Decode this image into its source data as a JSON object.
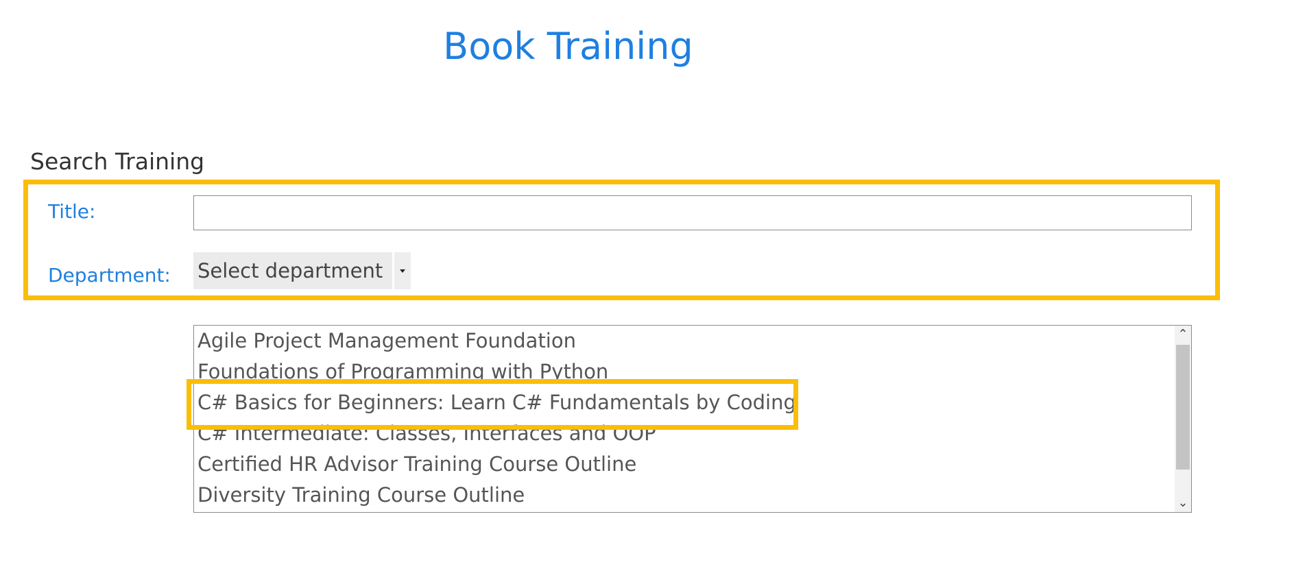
{
  "page": {
    "title": "Book Training"
  },
  "search": {
    "heading": "Search Training",
    "title_label": "Title:",
    "title_value": "",
    "department_label": "Department:",
    "department_value": "Select department"
  },
  "courses": {
    "items": [
      "Agile Project Management Foundation",
      "Foundations of Programming with Python",
      "C# Basics for Beginners: Learn C# Fundamentals by Coding",
      "C# Intermediate: Classes, Interfaces and OOP",
      "Certified HR Advisor Training Course Outline",
      "Diversity Training Course Outline"
    ],
    "highlighted_item": "C# Basics for Beginners: Learn C# Fundamentals by Coding"
  },
  "icons": {
    "scroll_up": "chevron-up-icon",
    "scroll_down": "chevron-down-icon",
    "dropdown": "caret-down-icon"
  },
  "colors": {
    "accent": "#1f7fe0",
    "highlight": "#fbbd08",
    "text": "#555555"
  }
}
